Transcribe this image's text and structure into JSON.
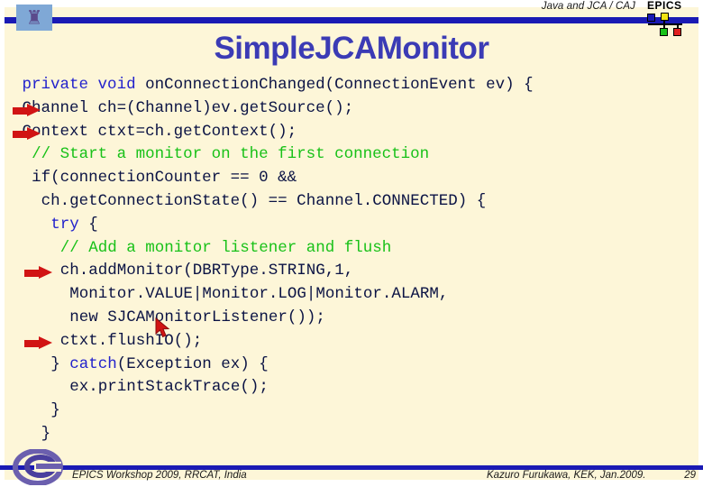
{
  "header": {
    "subtitle": "Java and JCA / CAJ",
    "logo_word": "EPICS",
    "crest_glyph": "♜"
  },
  "title": "SimpleJCAMonitor",
  "code": {
    "lines": [
      {
        "indent": 1,
        "arrow": false,
        "segments": [
          {
            "text": "private void ",
            "style": "kw"
          },
          {
            "text": "onConnectionChanged(ConnectionEvent ev) {",
            "style": "plain"
          }
        ]
      },
      {
        "indent": 1,
        "arrow": true,
        "segments": [
          {
            "text": "Channel ch=(Channel)ev.getSource();",
            "style": "plain"
          }
        ]
      },
      {
        "indent": 1,
        "arrow": true,
        "segments": [
          {
            "text": "Context ctxt=ch.getContext();",
            "style": "plain"
          }
        ]
      },
      {
        "indent": 2,
        "arrow": false,
        "segments": [
          {
            "text": "// Start a monitor on the first connection",
            "style": "cmt"
          }
        ]
      },
      {
        "indent": 2,
        "arrow": false,
        "segments": [
          {
            "text": "if(connectionCounter == 0 &&",
            "style": "plain"
          }
        ]
      },
      {
        "indent": 3,
        "arrow": false,
        "segments": [
          {
            "text": "ch.getConnectionState() == Channel.CONNECTED) {",
            "style": "plain"
          }
        ]
      },
      {
        "indent": 4,
        "arrow": false,
        "segments": [
          {
            "text": "try ",
            "style": "kw"
          },
          {
            "text": "{",
            "style": "plain"
          }
        ]
      },
      {
        "indent": 5,
        "arrow": false,
        "segments": [
          {
            "text": "// Add a monitor listener and flush",
            "style": "cmt"
          }
        ]
      },
      {
        "indent": 5,
        "arrow": true,
        "segments": [
          {
            "text": "ch.addMonitor(DBRType.STRING,1,",
            "style": "plain"
          }
        ]
      },
      {
        "indent": 6,
        "arrow": false,
        "segments": [
          {
            "text": "Monitor.VALUE|Monitor.LOG|Monitor.ALARM,",
            "style": "plain"
          }
        ]
      },
      {
        "indent": 6,
        "arrow": false,
        "segments": [
          {
            "text": "new SJCAMonitorListener());",
            "style": "plain"
          }
        ]
      },
      {
        "indent": 5,
        "arrow": true,
        "segments": [
          {
            "text": "ctxt.flushIO();",
            "style": "plain"
          }
        ]
      },
      {
        "indent": 4,
        "arrow": false,
        "segments": [
          {
            "text": "} ",
            "style": "plain"
          },
          {
            "text": "catch",
            "style": "kw"
          },
          {
            "text": "(Exception ex) {",
            "style": "plain"
          }
        ]
      },
      {
        "indent": 6,
        "arrow": false,
        "segments": [
          {
            "text": "ex.printStackTrace();",
            "style": "plain"
          }
        ]
      },
      {
        "indent": 4,
        "arrow": false,
        "segments": [
          {
            "text": "}",
            "style": "plain"
          }
        ]
      },
      {
        "indent": 3,
        "arrow": false,
        "segments": [
          {
            "text": "}",
            "style": "plain"
          }
        ]
      }
    ]
  },
  "footer": {
    "left": "EPICS Workshop 2009, RRCAT, India",
    "right": "Kazuro Furukawa, KEK, Jan.2009.",
    "page_number": "29"
  },
  "colors": {
    "panel_background": "#fdf6d8",
    "rule_blue": "#1a1ab4",
    "title_blue": "#3b3bb5",
    "code_text": "#0b1344",
    "keyword_blue": "#2222cc",
    "comment_green": "#18c118",
    "arrow_red": "#d11414"
  }
}
